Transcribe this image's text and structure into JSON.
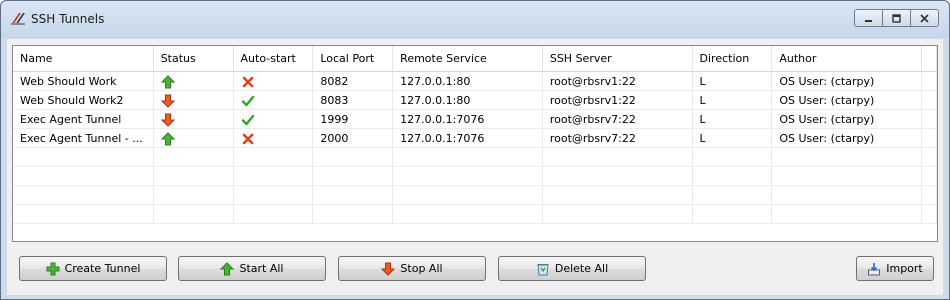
{
  "window": {
    "title": "SSH Tunnels",
    "controls": [
      "minimize",
      "maximize",
      "close"
    ]
  },
  "table": {
    "columns": [
      "Name",
      "Status",
      "Auto-start",
      "Local Port",
      "Remote Service",
      "SSH Server",
      "Direction",
      "Author"
    ],
    "rows": [
      {
        "name": "Web Should Work",
        "status": "up",
        "autostart": "no",
        "local_port": "8082",
        "remote_service": "127.0.0.1:80",
        "ssh_server": "root@rbsrv1:22",
        "direction": "L",
        "author": "OS User: (ctarpy)"
      },
      {
        "name": "Web Should Work2",
        "status": "down",
        "autostart": "yes",
        "local_port": "8083",
        "remote_service": "127.0.0.1:80",
        "ssh_server": "root@rbsrv1:22",
        "direction": "L",
        "author": "OS User: (ctarpy)"
      },
      {
        "name": "Exec Agent Tunnel",
        "status": "down",
        "autostart": "yes",
        "local_port": "1999",
        "remote_service": "127.0.0.1:7076",
        "ssh_server": "root@rbsrv7:22",
        "direction": "L",
        "author": "OS User: (ctarpy)"
      },
      {
        "name": "Exec Agent Tunnel - ...",
        "status": "up",
        "autostart": "no",
        "local_port": "2000",
        "remote_service": "127.0.0.1:7076",
        "ssh_server": "root@rbsrv7:22",
        "direction": "L",
        "author": "OS User: (ctarpy)"
      }
    ]
  },
  "buttons": {
    "create": "Create Tunnel",
    "start_all": "Start All",
    "stop_all": "Stop All",
    "delete_all": "Delete All",
    "import": "Import"
  },
  "colors": {
    "up_arrow": "#3fae2a",
    "down_arrow": "#e8541b",
    "check": "#2fa52b",
    "cross": "#e0401e"
  }
}
